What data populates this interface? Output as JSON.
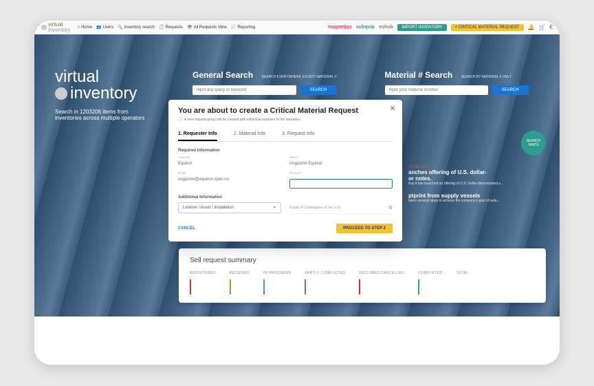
{
  "brand": {
    "line1": "virtual",
    "line2": "inventory"
  },
  "nav": {
    "items": [
      {
        "icon": "⌂",
        "label": "Home"
      },
      {
        "icon": "👥",
        "label": "Users"
      },
      {
        "icon": "🔍",
        "label": "Inventory search"
      },
      {
        "icon": "📋",
        "label": "Requests"
      },
      {
        "icon": "👁",
        "label": "All Requests View"
      },
      {
        "icon": "📈",
        "label": "Reporting"
      }
    ]
  },
  "partners": {
    "magnet": "magnetjqs",
    "subquip": "subquip",
    "eqhub": "eqhub"
  },
  "topbar": {
    "import": "IMPORT INVENTORY",
    "critical": "+ CRITICAL MATERIAL REQUEST",
    "icons": {
      "bell": "🔔",
      "cart": "🛒",
      "user": "€"
    }
  },
  "hero": {
    "title1": "virtual",
    "title2": "inventory",
    "sub": "Search in 1203206 items from inventories across multiple operators"
  },
  "search": {
    "general": {
      "title": "General Search",
      "hint": "SEARCH EVERYWHERE EXCEPT MATERIAL #",
      "placeholder": "Input any query or keyword",
      "button": "SEARCH"
    },
    "material": {
      "title": "Material # Search",
      "hint": "SEARCH BY MATERIAL # ONLY",
      "placeholder": "Input your material number",
      "button": "SEARCH"
    }
  },
  "hints_badge": "SEARCH HINTS",
  "news": [
    {
      "date": "23.06.2021",
      "title": "anches offering of U.S. dollar-",
      "title2": "or notes.",
      "body": "that it has launched an offering of U.S. Dollar-denominated s…"
    },
    {
      "title": "ptprint from supply vessels",
      "body": "taken several steps to achieve the company's goal of redu…"
    }
  ],
  "summary": {
    "title": "Sell request summary",
    "cols": [
      "REGISTERED",
      "RECEIVED",
      "IN PROGRESS",
      "PARTLY COMPLETED",
      "DECLINED/CANCELLED",
      "COMPLETED",
      "TOTAL"
    ]
  },
  "modal": {
    "title": "You are about to create a Critical Material Request",
    "sub": "A new request group will be created with individual requests to the operators",
    "steps": [
      "1. Requester Info",
      "2. Material Info",
      "3. Request Info"
    ],
    "required_label": "Required Information",
    "additional_label": "Additional Information",
    "fields": {
      "operator_label": "Operator",
      "operator_value": "Equinor",
      "name_label": "Name",
      "name_value": "Ungüzmir Equinor",
      "email_label": "Email",
      "email_value": "ungüzmir@equinor.open.no",
      "phone_label": "Phone #",
      "license_label": "License / Asset / Installation",
      "cc_label": "Email of Colleagues to be cc'd"
    },
    "cancel": "CANCEL",
    "proceed": "PROCEED TO STEP 2"
  }
}
